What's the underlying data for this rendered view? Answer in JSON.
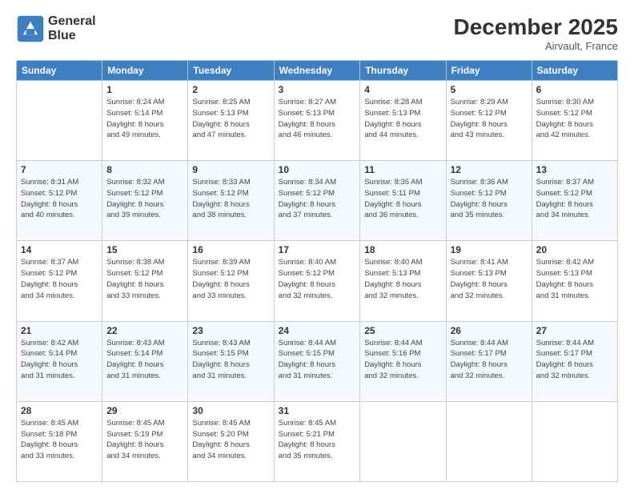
{
  "header": {
    "logo_line1": "General",
    "logo_line2": "Blue",
    "month_year": "December 2025",
    "location": "Airvault, France"
  },
  "weekdays": [
    "Sunday",
    "Monday",
    "Tuesday",
    "Wednesday",
    "Thursday",
    "Friday",
    "Saturday"
  ],
  "weeks": [
    [
      {
        "day": "",
        "info": ""
      },
      {
        "day": "1",
        "info": "Sunrise: 8:24 AM\nSunset: 5:14 PM\nDaylight: 8 hours\nand 49 minutes."
      },
      {
        "day": "2",
        "info": "Sunrise: 8:25 AM\nSunset: 5:13 PM\nDaylight: 8 hours\nand 47 minutes."
      },
      {
        "day": "3",
        "info": "Sunrise: 8:27 AM\nSunset: 5:13 PM\nDaylight: 8 hours\nand 46 minutes."
      },
      {
        "day": "4",
        "info": "Sunrise: 8:28 AM\nSunset: 5:13 PM\nDaylight: 8 hours\nand 44 minutes."
      },
      {
        "day": "5",
        "info": "Sunrise: 8:29 AM\nSunset: 5:12 PM\nDaylight: 8 hours\nand 43 minutes."
      },
      {
        "day": "6",
        "info": "Sunrise: 8:30 AM\nSunset: 5:12 PM\nDaylight: 8 hours\nand 42 minutes."
      }
    ],
    [
      {
        "day": "7",
        "info": "Sunrise: 8:31 AM\nSunset: 5:12 PM\nDaylight: 8 hours\nand 40 minutes."
      },
      {
        "day": "8",
        "info": "Sunrise: 8:32 AM\nSunset: 5:12 PM\nDaylight: 8 hours\nand 39 minutes."
      },
      {
        "day": "9",
        "info": "Sunrise: 8:33 AM\nSunset: 5:12 PM\nDaylight: 8 hours\nand 38 minutes."
      },
      {
        "day": "10",
        "info": "Sunrise: 8:34 AM\nSunset: 5:12 PM\nDaylight: 8 hours\nand 37 minutes."
      },
      {
        "day": "11",
        "info": "Sunrise: 8:35 AM\nSunset: 5:11 PM\nDaylight: 8 hours\nand 36 minutes."
      },
      {
        "day": "12",
        "info": "Sunrise: 8:36 AM\nSunset: 5:12 PM\nDaylight: 8 hours\nand 35 minutes."
      },
      {
        "day": "13",
        "info": "Sunrise: 8:37 AM\nSunset: 5:12 PM\nDaylight: 8 hours\nand 34 minutes."
      }
    ],
    [
      {
        "day": "14",
        "info": "Sunrise: 8:37 AM\nSunset: 5:12 PM\nDaylight: 8 hours\nand 34 minutes."
      },
      {
        "day": "15",
        "info": "Sunrise: 8:38 AM\nSunset: 5:12 PM\nDaylight: 8 hours\nand 33 minutes."
      },
      {
        "day": "16",
        "info": "Sunrise: 8:39 AM\nSunset: 5:12 PM\nDaylight: 8 hours\nand 33 minutes."
      },
      {
        "day": "17",
        "info": "Sunrise: 8:40 AM\nSunset: 5:12 PM\nDaylight: 8 hours\nand 32 minutes."
      },
      {
        "day": "18",
        "info": "Sunrise: 8:40 AM\nSunset: 5:13 PM\nDaylight: 8 hours\nand 32 minutes."
      },
      {
        "day": "19",
        "info": "Sunrise: 8:41 AM\nSunset: 5:13 PM\nDaylight: 8 hours\nand 32 minutes."
      },
      {
        "day": "20",
        "info": "Sunrise: 8:42 AM\nSunset: 5:13 PM\nDaylight: 8 hours\nand 31 minutes."
      }
    ],
    [
      {
        "day": "21",
        "info": "Sunrise: 8:42 AM\nSunset: 5:14 PM\nDaylight: 8 hours\nand 31 minutes."
      },
      {
        "day": "22",
        "info": "Sunrise: 8:43 AM\nSunset: 5:14 PM\nDaylight: 8 hours\nand 31 minutes."
      },
      {
        "day": "23",
        "info": "Sunrise: 8:43 AM\nSunset: 5:15 PM\nDaylight: 8 hours\nand 31 minutes."
      },
      {
        "day": "24",
        "info": "Sunrise: 8:44 AM\nSunset: 5:15 PM\nDaylight: 8 hours\nand 31 minutes."
      },
      {
        "day": "25",
        "info": "Sunrise: 8:44 AM\nSunset: 5:16 PM\nDaylight: 8 hours\nand 32 minutes."
      },
      {
        "day": "26",
        "info": "Sunrise: 8:44 AM\nSunset: 5:17 PM\nDaylight: 8 hours\nand 32 minutes."
      },
      {
        "day": "27",
        "info": "Sunrise: 8:44 AM\nSunset: 5:17 PM\nDaylight: 8 hours\nand 32 minutes."
      }
    ],
    [
      {
        "day": "28",
        "info": "Sunrise: 8:45 AM\nSunset: 5:18 PM\nDaylight: 8 hours\nand 33 minutes."
      },
      {
        "day": "29",
        "info": "Sunrise: 8:45 AM\nSunset: 5:19 PM\nDaylight: 8 hours\nand 34 minutes."
      },
      {
        "day": "30",
        "info": "Sunrise: 8:45 AM\nSunset: 5:20 PM\nDaylight: 8 hours\nand 34 minutes."
      },
      {
        "day": "31",
        "info": "Sunrise: 8:45 AM\nSunset: 5:21 PM\nDaylight: 8 hours\nand 35 minutes."
      },
      {
        "day": "",
        "info": ""
      },
      {
        "day": "",
        "info": ""
      },
      {
        "day": "",
        "info": ""
      }
    ]
  ]
}
